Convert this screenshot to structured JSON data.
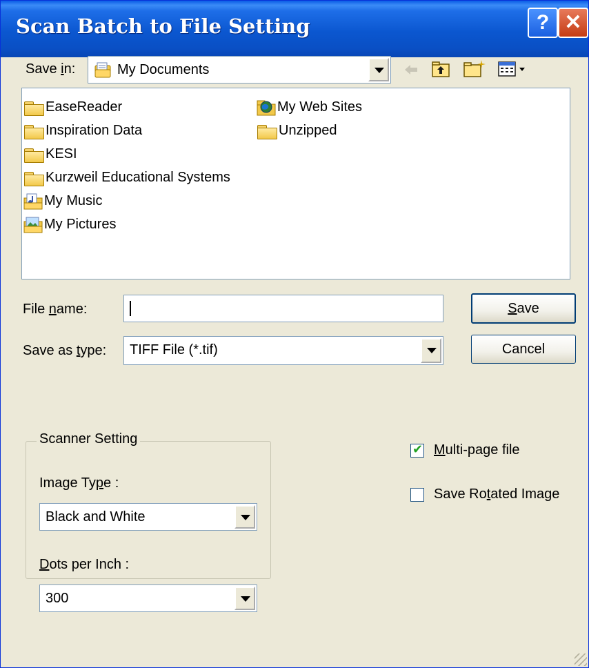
{
  "window": {
    "title": "Scan Batch to File Setting",
    "help_glyph": "?",
    "close_glyph": "✕"
  },
  "save_in": {
    "label_prefix": "Save ",
    "label_mnemonic": "i",
    "label_suffix": "n:",
    "value": "My Documents",
    "toolbar_icons": [
      "back-arrow-icon",
      "up-folder-icon",
      "new-folder-icon",
      "view-menu-icon"
    ]
  },
  "files": [
    {
      "name": "EaseReader",
      "icon": "folder-icon"
    },
    {
      "name": "Inspiration Data",
      "icon": "folder-icon"
    },
    {
      "name": "KESI",
      "icon": "folder-icon"
    },
    {
      "name": "Kurzweil Educational Systems",
      "icon": "folder-icon"
    },
    {
      "name": "My Music",
      "icon": "music-folder-icon"
    },
    {
      "name": "My Pictures",
      "icon": "pictures-folder-icon"
    },
    {
      "name": "My Web Sites",
      "icon": "web-folder-icon"
    },
    {
      "name": "Unzipped",
      "icon": "folder-icon"
    }
  ],
  "file_name": {
    "label_prefix": "File ",
    "label_mnemonic": "n",
    "label_suffix": "ame:",
    "value": ""
  },
  "save_as_type": {
    "label_prefix": "Save as ",
    "label_mnemonic": "t",
    "label_suffix": "ype:",
    "value": "TIFF File (*.tif)"
  },
  "buttons": {
    "save_mnemonic": "S",
    "save_rest": "ave",
    "cancel": "Cancel"
  },
  "scanner": {
    "group_label": "Scanner Setting",
    "image_type_prefix": "Image Ty",
    "image_type_mnemonic": "p",
    "image_type_suffix": "e :",
    "image_type_value": "Black and White",
    "dpi_mnemonic": "D",
    "dpi_suffix": "ots per Inch :",
    "dpi_value": "300"
  },
  "options": {
    "multipage_mnemonic": "M",
    "multipage_rest": "ulti-page file",
    "multipage_checked": true,
    "rotated_prefix": "Save Ro",
    "rotated_mnemonic": "t",
    "rotated_suffix": "ated Image",
    "rotated_checked": false
  },
  "colors": {
    "titlebar": "#0a5ce6",
    "dialog_bg": "#ece9d8",
    "close_button": "#c43c14"
  }
}
